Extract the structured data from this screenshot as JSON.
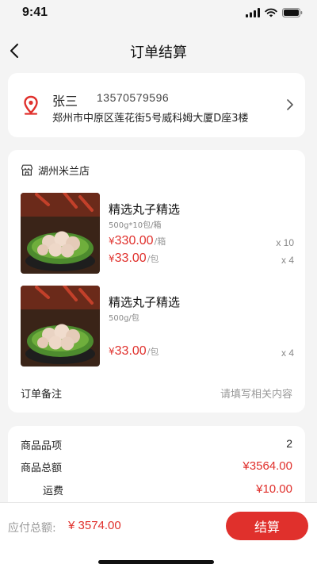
{
  "status_bar": {
    "time": "9:41"
  },
  "nav": {
    "title": "订单结算"
  },
  "address": {
    "name": "张三",
    "phone": "13570579596",
    "detail": "郑州市中原区莲花街5号威科姆大厦D座3楼"
  },
  "store": {
    "name": "湖州米兰店"
  },
  "products": [
    {
      "name": "精选丸子精选",
      "spec": "500g*10包/箱",
      "prices": [
        {
          "symbol": "¥",
          "amount": "330.00",
          "unit": "/箱",
          "qty": "x 10"
        },
        {
          "symbol": "¥",
          "amount": "33.00",
          "unit": "/包",
          "qty": "x 4"
        }
      ]
    },
    {
      "name": "精选丸子精选",
      "spec": "500g/包",
      "prices": [
        {
          "symbol": "¥",
          "amount": "33.00",
          "unit": "/包",
          "qty": "x 4"
        }
      ]
    }
  ],
  "remark": {
    "label": "订单备注",
    "placeholder": "请填写相关内容"
  },
  "summary": {
    "items_label": "商品品项",
    "items_value": "2",
    "total_label": "商品总额",
    "total_value": "¥3564.00",
    "shipping_label": "运费",
    "shipping_value": "¥10.00"
  },
  "footer": {
    "payable_label": "应付总额:",
    "payable_value": "¥ 3574.00",
    "submit_label": "结算"
  },
  "colors": {
    "accent": "#e0302c",
    "background": "#f4f4f4"
  }
}
